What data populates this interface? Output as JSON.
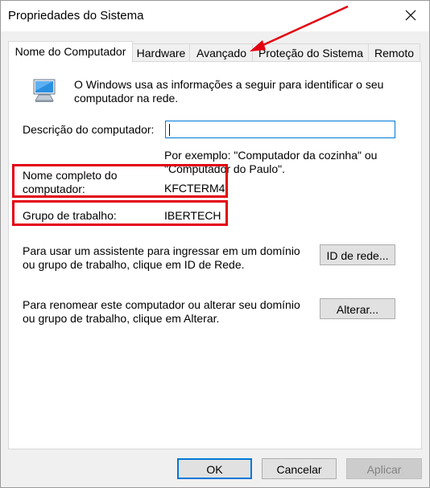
{
  "window": {
    "title": "Propriedades do Sistema"
  },
  "tabs": [
    {
      "label": "Nome do Computador"
    },
    {
      "label": "Hardware"
    },
    {
      "label": "Avançado"
    },
    {
      "label": "Proteção do Sistema"
    },
    {
      "label": "Remoto"
    }
  ],
  "panel": {
    "intro": "O Windows usa as informações a seguir para identificar o seu computador na rede.",
    "description_label": "Descrição do computador:",
    "description_value": "",
    "example_text": "Por exemplo: \"Computador da cozinha\" ou \"Computador do Paulo\".",
    "full_name_label": "Nome completo do computador:",
    "full_name_value": "KFCTERM4",
    "workgroup_label": "Grupo de trabalho:",
    "workgroup_value": "IBERTECH",
    "domain_help": "Para usar um assistente para ingressar em um domínio ou grupo de trabalho, clique em ID de Rede.",
    "network_id_button": "ID de rede...",
    "rename_help": "Para renomear este computador ou alterar seu domínio ou grupo de trabalho, clique em Alterar.",
    "change_button": "Alterar..."
  },
  "footer": {
    "ok": "OK",
    "cancel": "Cancelar",
    "apply": "Aplicar"
  },
  "colors": {
    "annotation": "#e3000f",
    "focus": "#0078d7"
  },
  "icons": {
    "computer": "computer-monitor-icon",
    "close": "close-icon"
  }
}
